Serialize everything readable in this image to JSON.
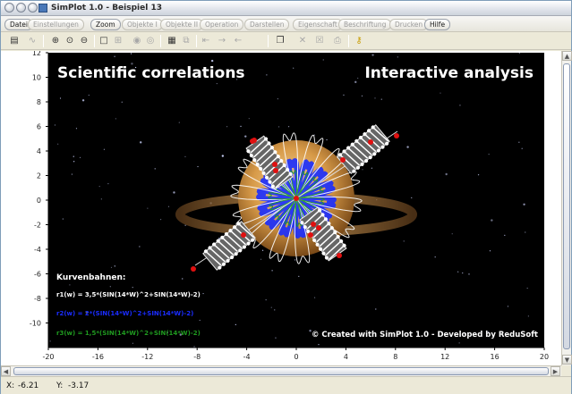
{
  "window": {
    "title": "SimPlot 1.0 - Beispiel 13"
  },
  "menu": [
    {
      "label": "Datei",
      "enabled": true
    },
    {
      "label": "Einstellungen",
      "enabled": false
    },
    {
      "label": "Zoom",
      "enabled": true
    },
    {
      "label": "Objekte I",
      "enabled": false
    },
    {
      "label": "Objekte II",
      "enabled": false
    },
    {
      "label": "Operation",
      "enabled": false
    },
    {
      "label": "Darstellen",
      "enabled": false
    },
    {
      "label": "Eigenschaft",
      "enabled": false
    },
    {
      "label": "Beschriftung",
      "enabled": false
    },
    {
      "label": "Drucken",
      "enabled": false
    },
    {
      "label": "Hilfe",
      "enabled": true
    }
  ],
  "toolbar": {
    "icons": [
      "calculator-icon",
      "curve-icon",
      "zoom-in-icon",
      "zoom-fit-icon",
      "zoom-out-icon",
      "frame-icon",
      "grid-icon",
      "point-icon",
      "ring-icon",
      "table-icon",
      "shape-icon",
      "copy-left-icon",
      "arrow-right-icon",
      "arrow-left-icon",
      "page-icon",
      "cross-icon",
      "cross-box-icon",
      "printer-icon",
      "key-icon"
    ]
  },
  "plot": {
    "title_left": "Scientific correlations",
    "title_right": "Interactive analysis",
    "legend_title": "Kurvenbahnen:",
    "legend": [
      {
        "text": "r1(w) = 3,5*(SIN(14*W)^2+SIN(14*W)-2)",
        "color": "#ffffff"
      },
      {
        "text": "r2(w) = 2*(SIN(14*W)^2+SIN(14*W)-2)",
        "color": "#1a2cff"
      },
      {
        "text": "r3(w) = 1,5*(SIN(14*W)^2+SIN(14*W)-2)",
        "color": "#1f9a1f"
      }
    ],
    "credit": "© Created with SimPlot 1.0 - Developed by ReduSoft",
    "x_ticks": [
      "-20",
      "-16",
      "-12",
      "-8",
      "-4",
      "0",
      "4",
      "8",
      "12",
      "16",
      "20"
    ],
    "y_ticks": [
      "12",
      "10",
      "8",
      "6",
      "4",
      "2",
      "0",
      "-2",
      "-4",
      "-6",
      "-8",
      "-10"
    ],
    "xlim": [
      -20,
      20
    ],
    "ylim": [
      -12,
      12
    ],
    "colors": {
      "background": "#000000",
      "marker": "#e01010"
    }
  },
  "status": {
    "x_label": "X:",
    "x_value": "-6.21",
    "y_label": "Y:",
    "y_value": "-3.17"
  }
}
